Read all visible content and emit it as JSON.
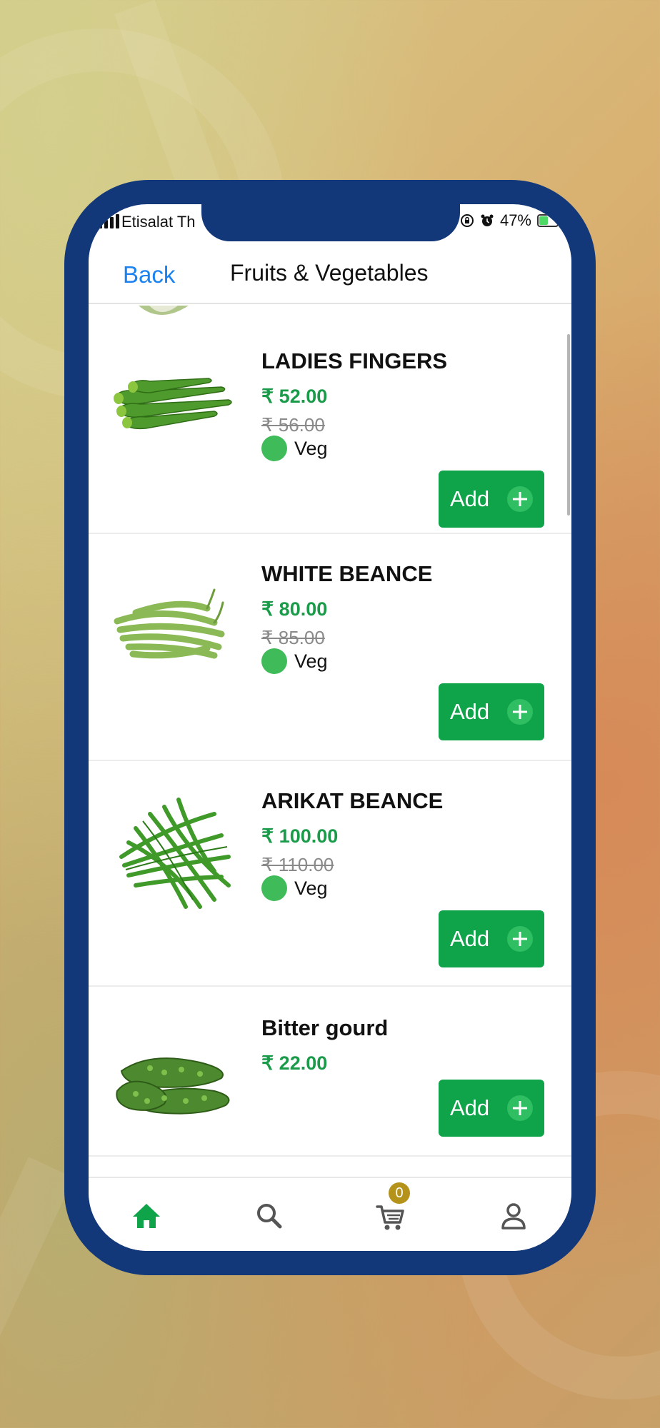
{
  "status_bar": {
    "carrier": "Etisalat Th",
    "battery_percent": "47%",
    "battery_level": 0.47
  },
  "header": {
    "back_label": "Back",
    "title": "Fruits & Vegetables"
  },
  "currency_symbol": "₹",
  "products": [
    {
      "name": "LADIES FINGERS",
      "price": "₹ 52.00",
      "mrp": "₹ 56.00",
      "veg_label": "Veg",
      "add_label": "Add",
      "image_icon": "okra-image"
    },
    {
      "name": "WHITE BEANCE",
      "price": "₹ 80.00",
      "mrp": "₹ 85.00",
      "veg_label": "Veg",
      "add_label": "Add",
      "image_icon": "green-beans-image"
    },
    {
      "name": "ARIKAT BEANCE",
      "price": "₹ 100.00",
      "mrp": "₹ 110.00",
      "veg_label": "Veg",
      "add_label": "Add",
      "image_icon": "beans-image"
    },
    {
      "name": "Bitter gourd",
      "price": "₹ 22.00",
      "add_label": "Add",
      "image_icon": "bitter-gourd-image"
    }
  ],
  "tabbar": {
    "items": [
      "home-icon",
      "search-icon",
      "cart-icon",
      "profile-icon"
    ],
    "active": "home-icon",
    "cart_count": "0"
  },
  "colors": {
    "frame": "#13387a",
    "price_green": "#1a9b4a",
    "add_button": "#10a44a",
    "veg_dot": "#3fbb59",
    "back_link": "#1b82f0",
    "badge": "#b5921a"
  }
}
